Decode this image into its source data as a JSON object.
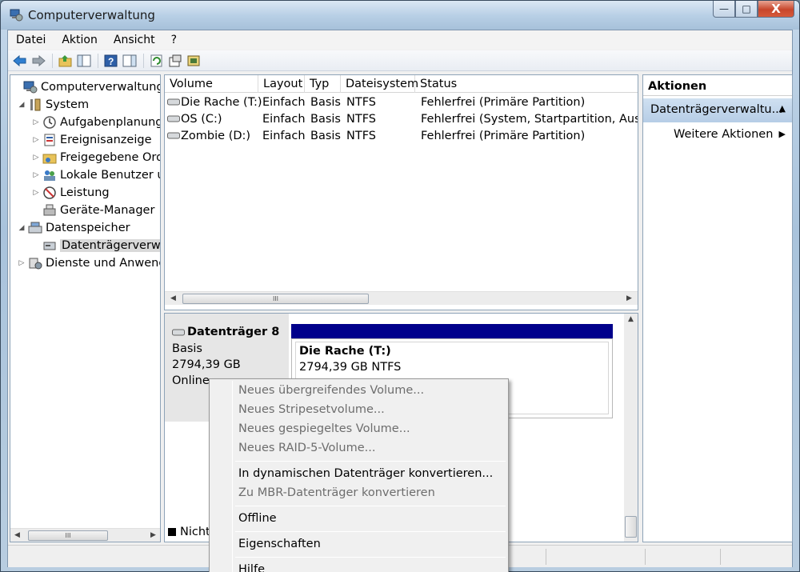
{
  "window": {
    "title": "Computerverwaltung"
  },
  "caption_buttons": {
    "minimize": "—",
    "maximize": "□",
    "close": "X"
  },
  "menubar": [
    "Datei",
    "Aktion",
    "Ansicht",
    "?"
  ],
  "tree": [
    {
      "label": "Computerverwaltung (Lo",
      "expander": "",
      "icon": "computer-management-icon"
    },
    {
      "label": "System",
      "expander": "◢",
      "icon": "tools-icon"
    },
    {
      "label": "Aufgabenplanung",
      "expander": "▷",
      "icon": "clock-icon"
    },
    {
      "label": "Ereignisanzeige",
      "expander": "▷",
      "icon": "event-viewer-icon"
    },
    {
      "label": "Freigegebene Ordn",
      "expander": "▷",
      "icon": "shared-folder-icon"
    },
    {
      "label": "Lokale Benutzer un",
      "expander": "▷",
      "icon": "users-icon"
    },
    {
      "label": "Leistung",
      "expander": "▷",
      "icon": "performance-icon"
    },
    {
      "label": "Geräte-Manager",
      "expander": "",
      "icon": "device-manager-icon"
    },
    {
      "label": "Datenspeicher",
      "expander": "◢",
      "icon": "storage-icon"
    },
    {
      "label": "Datenträgerverwalt",
      "expander": "",
      "icon": "disk-management-icon"
    },
    {
      "label": "Dienste und Anwendu",
      "expander": "▷",
      "icon": "services-icon"
    }
  ],
  "volume_list": {
    "columns": [
      "Volume",
      "Layout",
      "Typ",
      "Dateisystem",
      "Status"
    ],
    "rows": [
      {
        "volume": "Die Rache (T:)",
        "layout": "Einfach",
        "typ": "Basis",
        "fs": "NTFS",
        "status": "Fehlerfrei (Primäre Partition)"
      },
      {
        "volume": "OS (C:)",
        "layout": "Einfach",
        "typ": "Basis",
        "fs": "NTFS",
        "status": "Fehlerfrei (System, Startpartition, Auslage"
      },
      {
        "volume": "Zombie (D:)",
        "layout": "Einfach",
        "typ": "Basis",
        "fs": "NTFS",
        "status": "Fehlerfrei (Primäre Partition)"
      }
    ]
  },
  "disk": {
    "name": "Datenträger 8",
    "type": "Basis",
    "size": "2794,39 GB",
    "state": "Online",
    "partition_name": "Die Rache  (T:)",
    "partition_info": "2794,39 GB NTFS"
  },
  "legend": {
    "label": "Nicht"
  },
  "actions": {
    "header": "Aktionen",
    "section": "Datenträgerverwaltu...",
    "item": "Weitere Aktionen"
  },
  "context_menu": {
    "items": [
      {
        "label": "Neues übergreifendes Volume...",
        "disabled": true
      },
      {
        "label": "Neues Stripesetvolume...",
        "disabled": true
      },
      {
        "label": "Neues gespiegeltes Volume...",
        "disabled": true
      },
      {
        "label": "Neues RAID-5-Volume...",
        "disabled": true
      },
      {
        "label": "In dynamischen Datenträger konvertieren...",
        "disabled": false
      },
      {
        "label": "Zu MBR-Datenträger konvertieren",
        "disabled": true
      },
      {
        "label": "Offline",
        "disabled": false
      },
      {
        "label": "Eigenschaften",
        "disabled": false
      },
      {
        "label": "Hilfe",
        "disabled": false
      }
    ]
  },
  "scroll_thumb_glyph": "III"
}
